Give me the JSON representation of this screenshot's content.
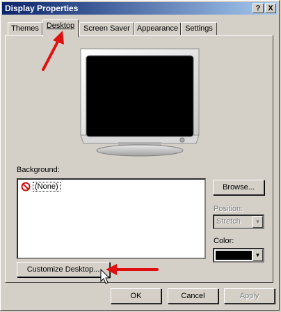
{
  "window": {
    "title": "Display Properties",
    "help_button": "?",
    "close_button": "X"
  },
  "tabs": [
    {
      "label": "Themes"
    },
    {
      "label": "Desktop",
      "active": true
    },
    {
      "label": "Screen Saver"
    },
    {
      "label": "Appearance"
    },
    {
      "label": "Settings"
    }
  ],
  "background": {
    "label": "Background:",
    "items": [
      {
        "label": "(None)",
        "icon": "none-icon",
        "selected": true
      }
    ]
  },
  "browse_button": "Browse...",
  "position": {
    "label": "Position:",
    "value": "Stretch",
    "enabled": false
  },
  "color": {
    "label": "Color:",
    "value": "#000000"
  },
  "customize_button": "Customize Desktop...",
  "footer": {
    "ok": "OK",
    "cancel": "Cancel",
    "apply": "Apply"
  },
  "colors": {
    "titlebar_start": "#0a246a",
    "titlebar_end": "#a6caf0",
    "dialog_face": "#d4d0c8",
    "annotation_arrow": "#e01010"
  },
  "icons": [
    "help-icon",
    "close-icon",
    "monitor-preview",
    "none-icon",
    "dropdown-arrow-icon",
    "mouse-cursor-icon",
    "annotation-arrow"
  ]
}
